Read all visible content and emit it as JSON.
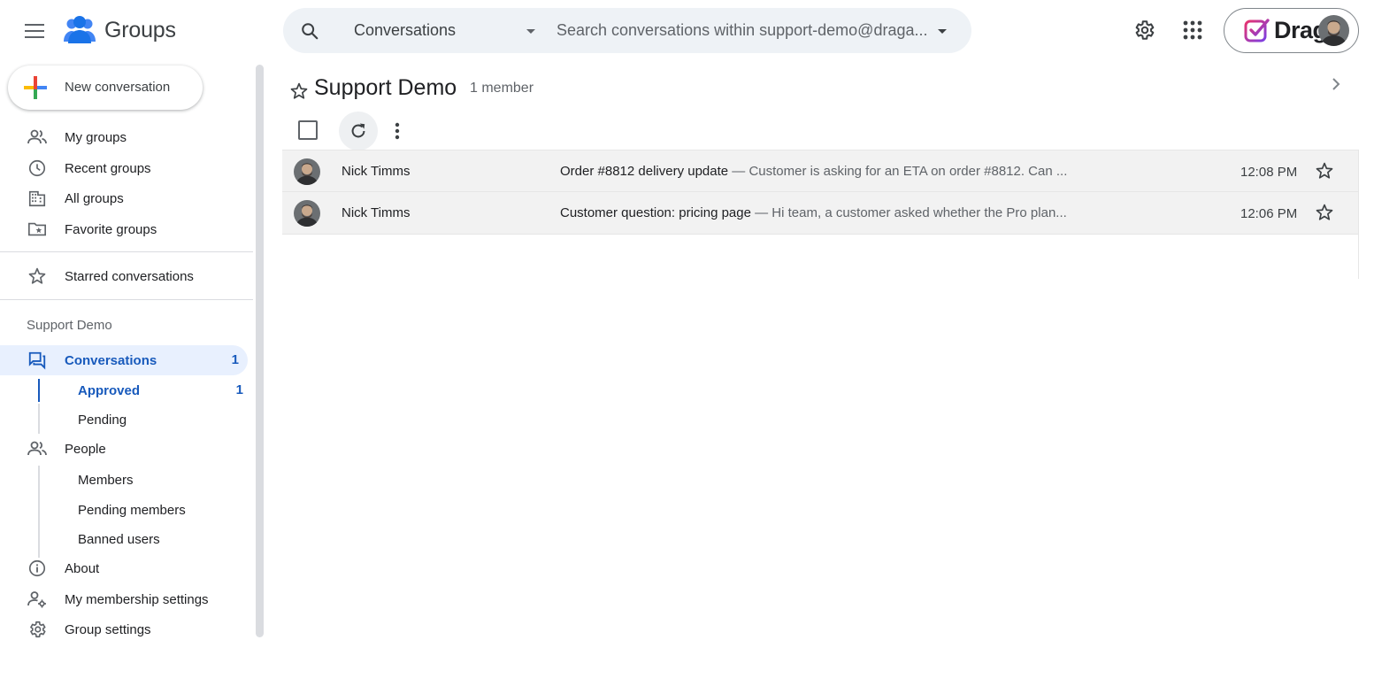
{
  "header": {
    "app_name": "Groups",
    "search_scope": "Conversations",
    "search_placeholder": "Search conversations within support-demo@draga...",
    "account_brand": "Drag"
  },
  "sidebar": {
    "new_conversation": "New conversation",
    "nav": [
      {
        "label": "My groups",
        "icon": "people-icon"
      },
      {
        "label": "Recent groups",
        "icon": "clock-icon"
      },
      {
        "label": "All groups",
        "icon": "building-icon"
      },
      {
        "label": "Favorite groups",
        "icon": "folder-star-icon"
      }
    ],
    "starred": "Starred conversations",
    "group_section_title": "Support Demo",
    "conversations": {
      "label": "Conversations",
      "count": "1"
    },
    "approved": {
      "label": "Approved",
      "count": "1"
    },
    "pending": "Pending",
    "people": "People",
    "members": "Members",
    "pending_members": "Pending members",
    "banned_users": "Banned users",
    "about": "About",
    "membership_settings": "My membership settings",
    "group_settings": "Group settings"
  },
  "main": {
    "group_title": "Support Demo",
    "member_count": "1 member",
    "conversations": [
      {
        "author": "Nick Timms",
        "subject": "Order #8812 delivery update",
        "snippet": " — Customer is asking for an ETA on order #8812. Can ...",
        "time": "12:08 PM"
      },
      {
        "author": "Nick Timms",
        "subject": "Customer question: pricing page",
        "snippet": " — Hi team, a customer asked whether the Pro plan...",
        "time": "12:06 PM"
      }
    ]
  },
  "colors": {
    "accent": "#185abc",
    "active_bg": "#e8f0fe",
    "search_bg": "#eef2f6",
    "row_bg": "#f2f2f2"
  }
}
